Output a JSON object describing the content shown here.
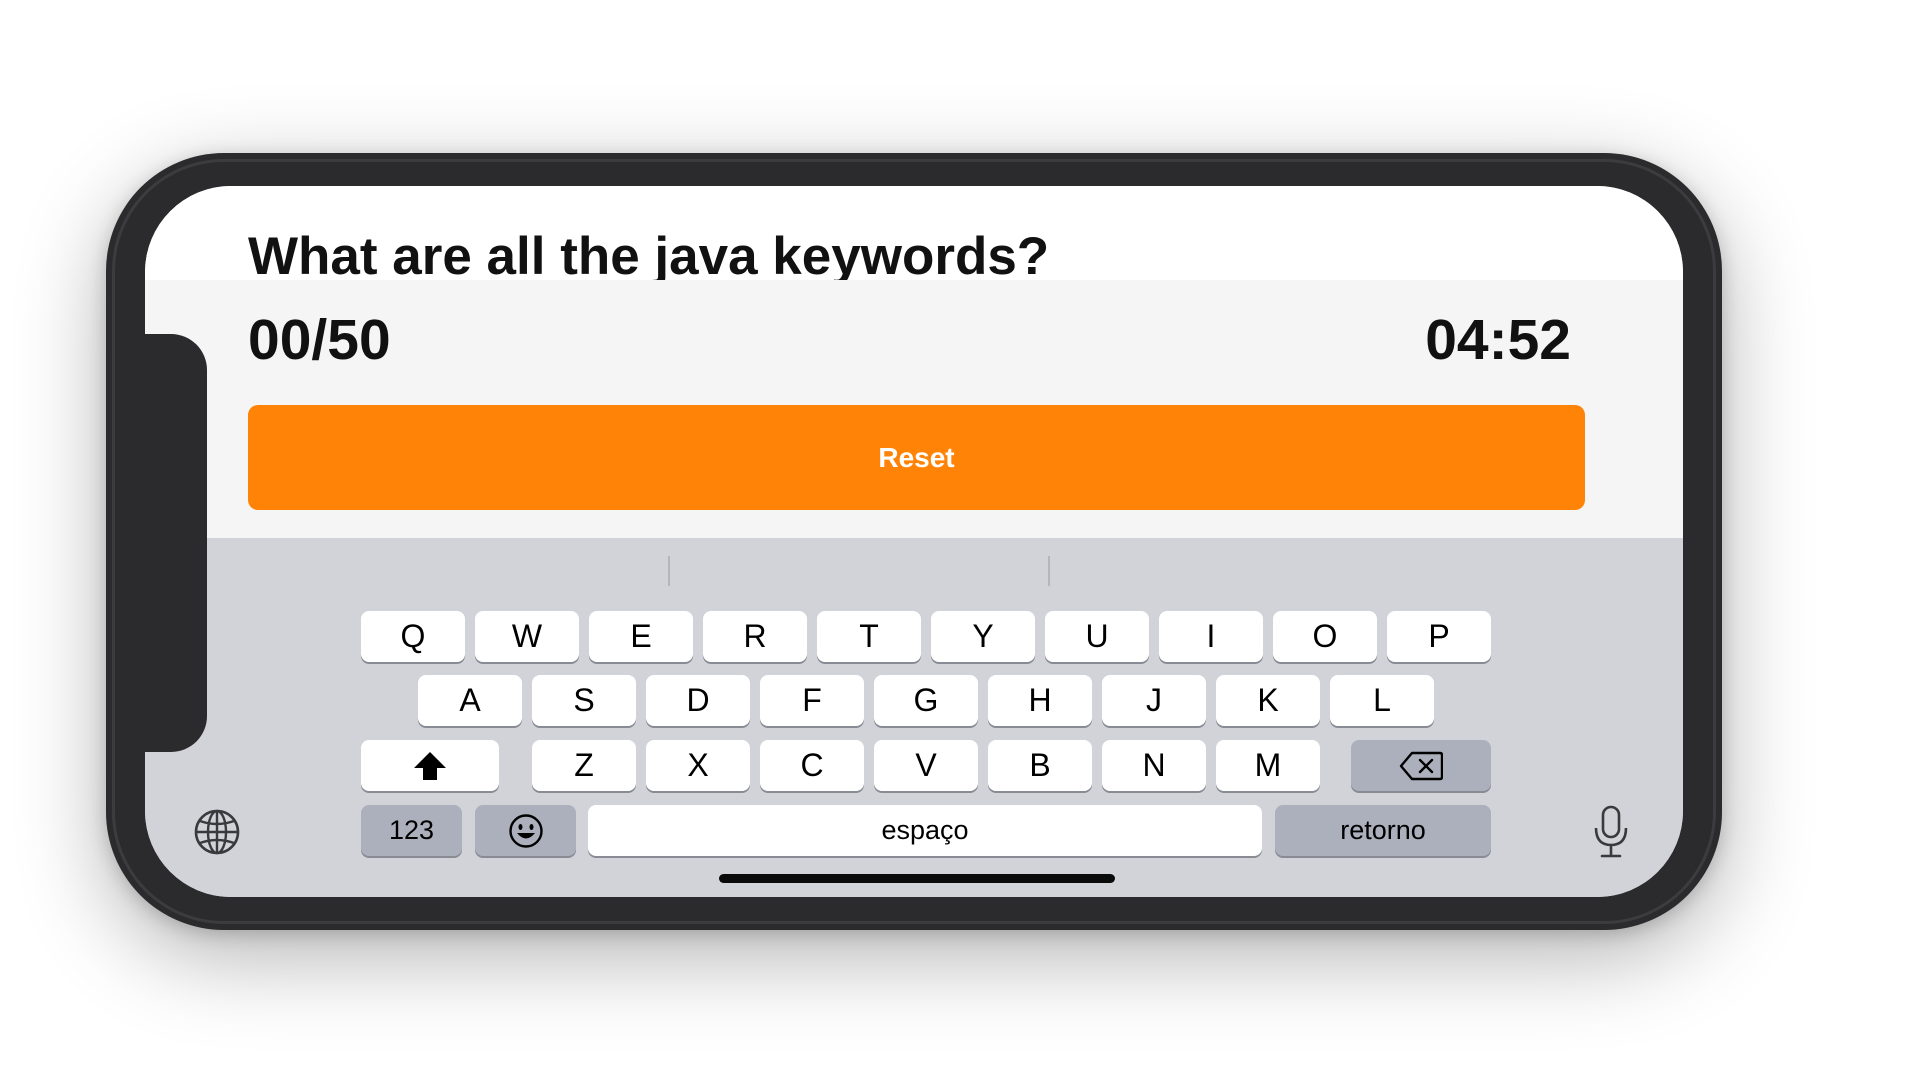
{
  "question": "What are all the java keywords?",
  "score": "00/50",
  "timer": "04:52",
  "reset_label": "Reset",
  "keyboard": {
    "row1": [
      "Q",
      "W",
      "E",
      "R",
      "T",
      "Y",
      "U",
      "I",
      "O",
      "P"
    ],
    "row2": [
      "A",
      "S",
      "D",
      "F",
      "G",
      "H",
      "J",
      "K",
      "L"
    ],
    "row3": [
      "Z",
      "X",
      "C",
      "V",
      "B",
      "N",
      "M"
    ],
    "numbers_label": "123",
    "space_label": "espaço",
    "return_label": "retorno",
    "icons": {
      "shift": "shift-icon",
      "backspace": "backspace-icon",
      "emoji": "emoji-icon",
      "globe": "globe-icon",
      "microphone": "microphone-icon"
    }
  },
  "colors": {
    "accent": "#ff8306",
    "frame": "#2b2a2c",
    "keyboard_bg": "#d1d3d9",
    "key_bg": "#ffffff",
    "key_dark_bg": "#abb0bc"
  }
}
